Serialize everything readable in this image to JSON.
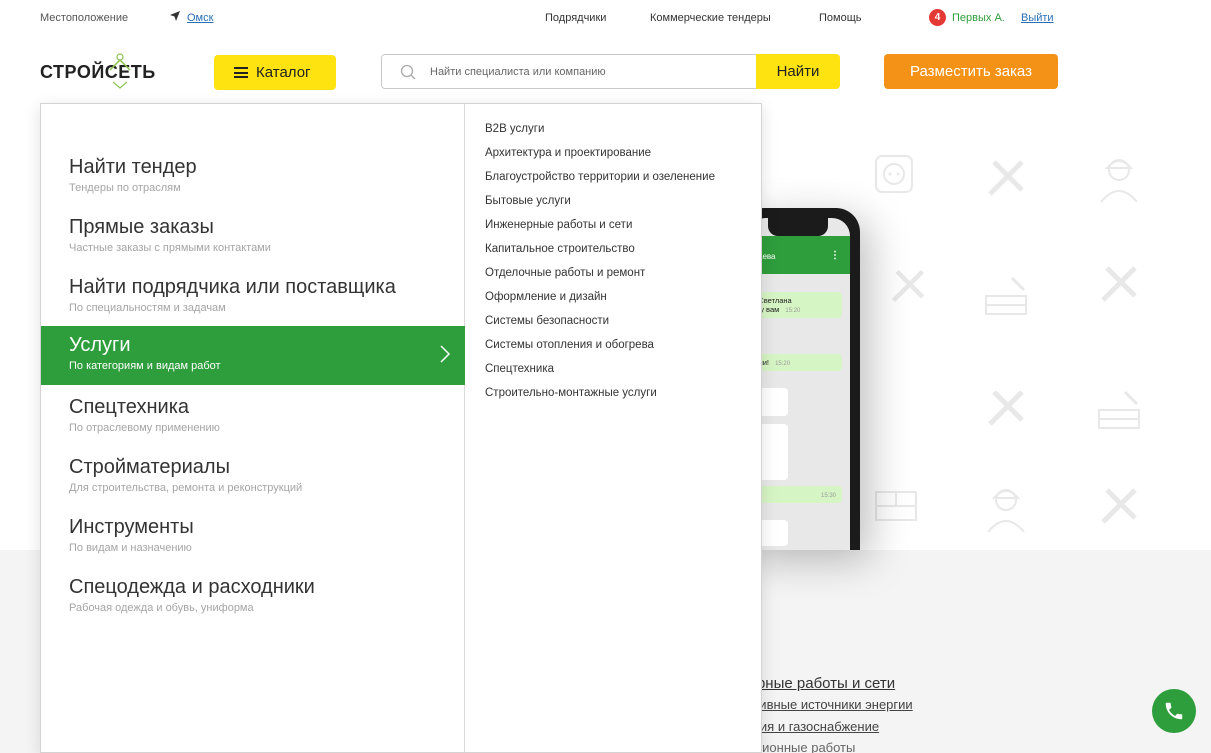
{
  "topbar": {
    "location_label": "Местоположение",
    "city": "Омск",
    "nav": [
      "Подрядчики",
      "Коммерческие тендеры",
      "Помощь"
    ],
    "notifications_count": "4",
    "user_name": "Первых А.",
    "logout": "Выйти"
  },
  "header": {
    "logo_text": "СТРОЙСЕТЬ",
    "catalog_label": "Каталог",
    "search_placeholder": "Найти специалиста или компанию",
    "search_button": "Найти",
    "order_button": "Разместить заказ"
  },
  "menu": {
    "categories": [
      {
        "title": "Найти тендер",
        "subtitle": "Тендеры по отраслям"
      },
      {
        "title": "Прямые заказы",
        "subtitle": "Частные заказы с прямыми контактами"
      },
      {
        "title": "Найти подрядчика или поставщика",
        "subtitle": "По специальностям и задачам"
      },
      {
        "title": "Услуги",
        "subtitle": "По категориям и видам работ"
      },
      {
        "title": "Спецтехника",
        "subtitle": "По отраслевому применению"
      },
      {
        "title": "Стройматериалы",
        "subtitle": "Для строительства, ремонта и реконструкций"
      },
      {
        "title": "Инструменты",
        "subtitle": "По видам и назначению"
      },
      {
        "title": "Спецодежда и расходники",
        "subtitle": "Рабочая одежда и обувь, униформа"
      }
    ],
    "active_index": 3,
    "subcategories": [
      "B2B услуги",
      "Архитектура и проектирование",
      "Благоустройство территории и озеленение",
      "Бытовые услуги",
      "Инженерные работы и сети",
      "Капитальное строительство",
      "Отделочные работы и ремонт",
      "Оформление и дизайн",
      "Системы безопасности",
      "Системы отопления и обогрева",
      "Спецтехника",
      "Строительно-монтажные услуги"
    ]
  },
  "phone": {
    "contact": "аева",
    "messages": [
      {
        "text": "е, Светлана\nишу вам",
        "time": "15:20"
      },
      {
        "text": "рали!",
        "time": "15:20"
      },
      {
        "text": "",
        "time": "15:30"
      }
    ]
  },
  "background": {
    "main_link": "енерные работы и сети",
    "sub_links": [
      "рнативные источники энергии",
      "икация и газоснабжение",
      "Изоляционные работы"
    ]
  },
  "colors": {
    "green": "#2e9d3c",
    "yellow": "#ffe311",
    "orange": "#f39217",
    "badge_red": "#e53935"
  }
}
